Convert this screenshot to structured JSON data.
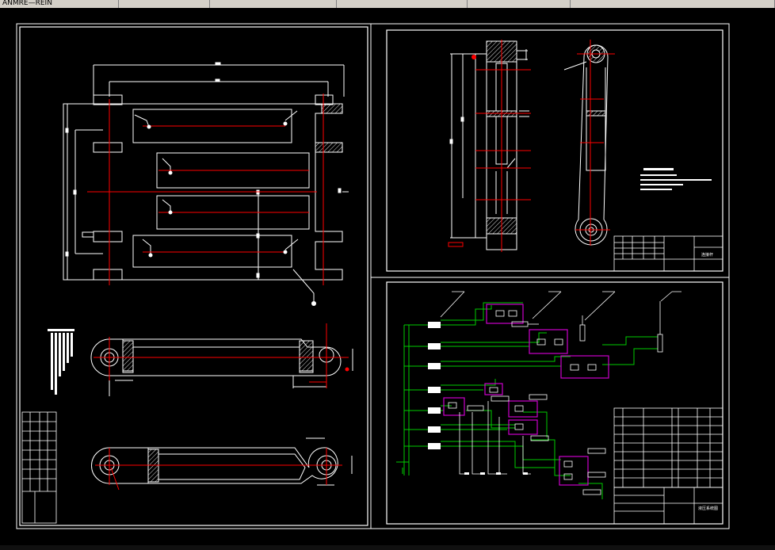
{
  "window": {
    "tabs": [
      {
        "label": "ANMRE—REIN"
      },
      {
        "label": ""
      },
      {
        "label": ""
      },
      {
        "label": ""
      },
      {
        "label": ""
      },
      {
        "label": ""
      }
    ]
  },
  "sheets": {
    "left": {
      "name": "assembly-drawing"
    },
    "top_right": {
      "name": "part-drawing",
      "title_block_name": "连接杆"
    },
    "bottom_right": {
      "name": "hydraulic-schematic",
      "title_block_name": "液压系统图"
    }
  },
  "colors": {
    "background": "#000000",
    "line_white": "#ffffff",
    "line_red": "#ff0000",
    "line_green": "#00cc00",
    "line_magenta": "#cc00cc",
    "hatch": "#dddddd"
  }
}
